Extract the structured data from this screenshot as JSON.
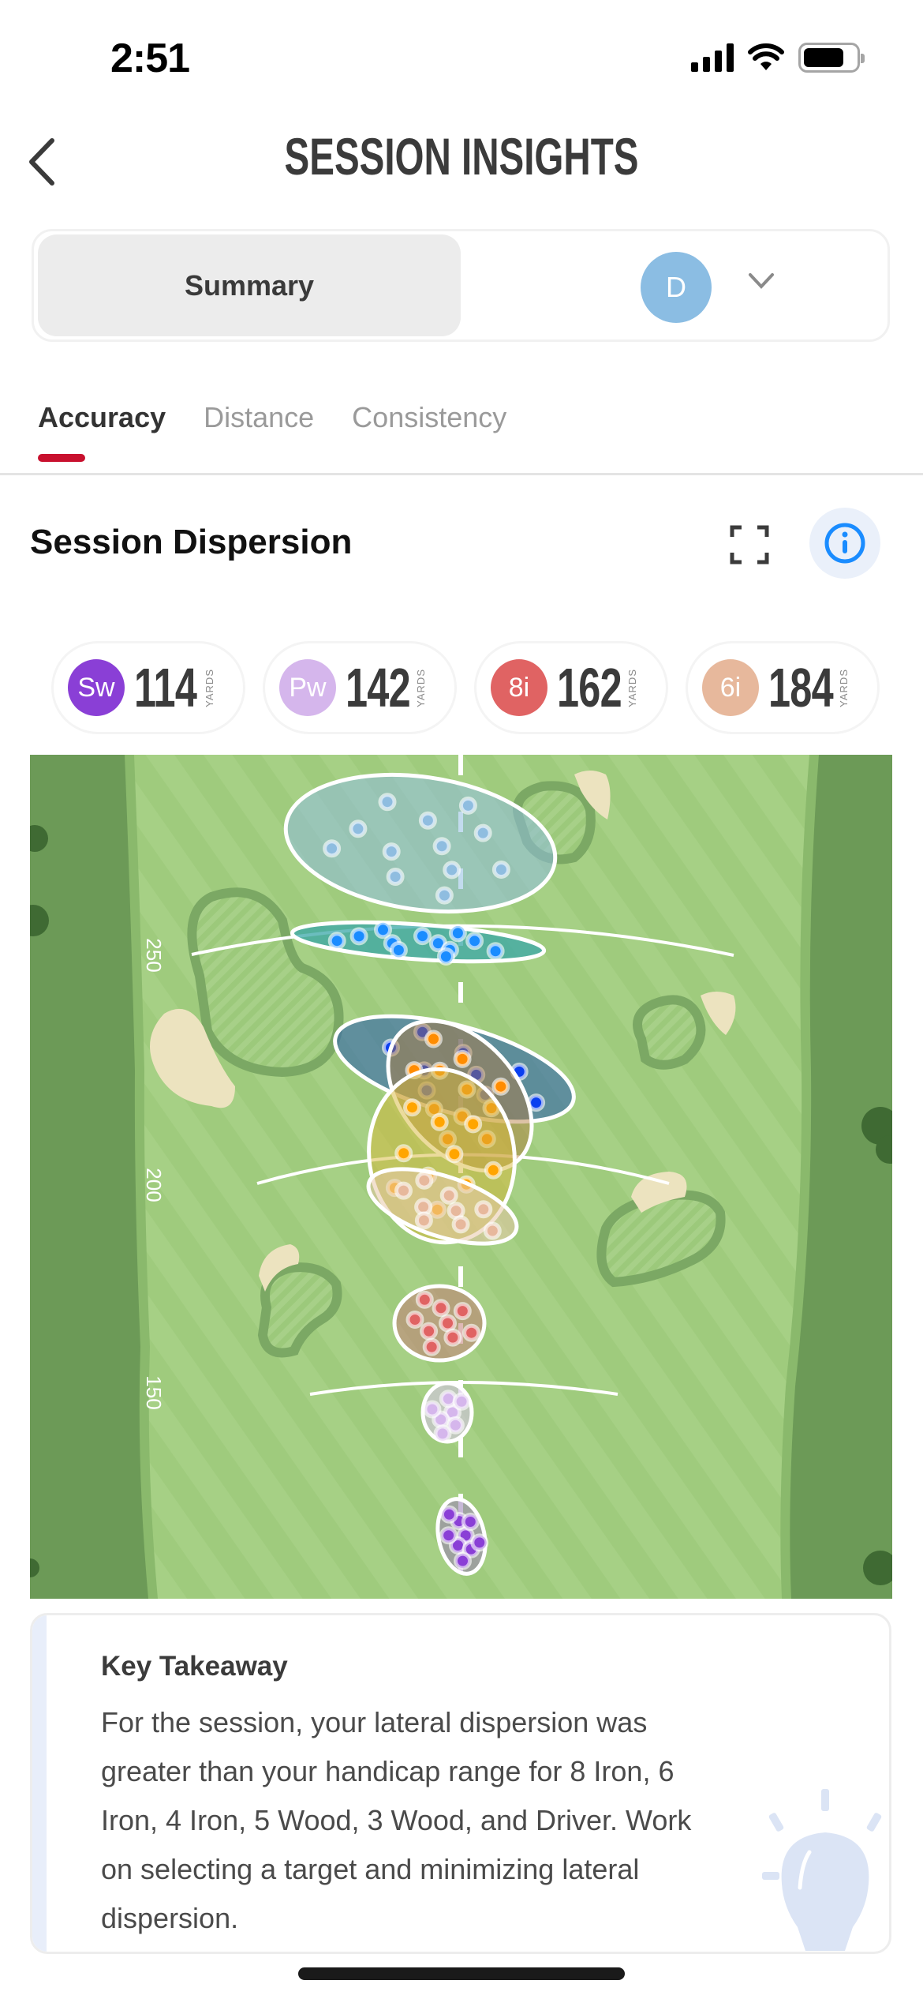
{
  "status_bar": {
    "time": "2:51",
    "icons": [
      "cellular-signal-icon",
      "wifi-icon",
      "battery-icon"
    ]
  },
  "nav": {
    "back_icon": "chevron-left-icon",
    "title": "SESSION INSIGHTS"
  },
  "segment": {
    "summary_label": "Summary",
    "selected_club_initial": "D",
    "selected_club_color": "#8bbde3",
    "dropdown_icon": "chevron-down-icon"
  },
  "tabs": [
    {
      "label": "Accuracy",
      "active": true
    },
    {
      "label": "Distance",
      "active": false
    },
    {
      "label": "Consistency",
      "active": false
    }
  ],
  "accent_color": "#c8102e",
  "section": {
    "title": "Session Dispersion",
    "expand_icon": "expand-icon",
    "info_icon": "info-icon"
  },
  "club_chips": [
    {
      "abbr": "Sw",
      "value": "114",
      "unit": "YARDS",
      "color": "#8a3fd6"
    },
    {
      "abbr": "Pw",
      "value": "142",
      "unit": "YARDS",
      "color": "#d5b6ec"
    },
    {
      "abbr": "8i",
      "value": "162",
      "unit": "YARDS",
      "color": "#e06363"
    },
    {
      "abbr": "6i",
      "value": "184",
      "unit": "YARDS",
      "color": "#e7b89c"
    }
  ],
  "map": {
    "distance_markers": [
      "250",
      "200",
      "150"
    ],
    "dispersion_groups": [
      {
        "club": "light-blue",
        "fill": "#8fbde0",
        "dot": "#8fbde0"
      },
      {
        "club": "blue-teal",
        "fill": "#3aa7a8",
        "dot": "#1a8cff"
      },
      {
        "club": "dark-blue",
        "fill": "#3a6cab",
        "dot": "#0a3ff0"
      },
      {
        "club": "orange",
        "fill": "#b4783a",
        "dot": "#ff8c00"
      },
      {
        "club": "yellow",
        "fill": "#d8b83a",
        "dot": "#ffa500"
      },
      {
        "club": "6i",
        "fill": "#e7c8a8",
        "dot": "#e7b89c"
      },
      {
        "club": "8i",
        "fill": "#c4807a",
        "dot": "#e06363"
      },
      {
        "club": "Pw",
        "fill": "#d5c4e6",
        "dot": "#d5b6ec"
      },
      {
        "club": "Sw",
        "fill": "#9a7fb8",
        "dot": "#8a3fd6"
      }
    ]
  },
  "takeaway": {
    "title": "Key Takeaway",
    "body": "For the session, your lateral dispersion was greater than your handicap range for 8 Iron, 6 Iron, 4 Iron, 5 Wood, 3 Wood, and Driver. Work on selecting a target and minimizing lateral dispersion.",
    "icon": "lightbulb-icon"
  }
}
